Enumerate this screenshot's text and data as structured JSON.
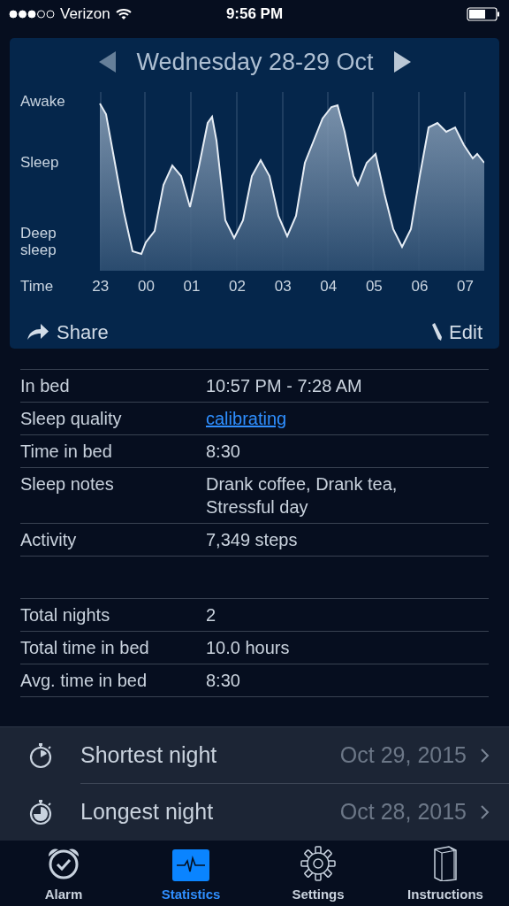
{
  "status_bar": {
    "carrier": "Verizon",
    "time": "9:56 PM"
  },
  "night_card": {
    "title": "Wednesday 28-29 Oct",
    "y_labels": [
      "Awake",
      "Sleep",
      "Deep sleep"
    ],
    "x_axis_label": "Time",
    "x_ticks": [
      "23",
      "00",
      "01",
      "02",
      "03",
      "04",
      "05",
      "06",
      "07"
    ],
    "share": "Share",
    "edit": "Edit"
  },
  "details": [
    {
      "label": "In bed",
      "value": "10:57 PM - 7:28 AM",
      "kind": "text"
    },
    {
      "label": "Sleep quality",
      "value": "calibrating",
      "kind": "link"
    },
    {
      "label": "Time in bed",
      "value": "8:30",
      "kind": "text"
    },
    {
      "label": "Sleep notes",
      "value": "Drank coffee, Drank tea, Stressful day",
      "kind": "text"
    },
    {
      "label": "Activity",
      "value": "7,349 steps",
      "kind": "text"
    }
  ],
  "totals": [
    {
      "label": "Total nights",
      "value": "2"
    },
    {
      "label": "Total time in bed",
      "value": "10.0 hours"
    },
    {
      "label": "Avg. time in bed",
      "value": "8:30"
    }
  ],
  "records": [
    {
      "label": "Shortest night",
      "date": "Oct 29, 2015",
      "kind": "shortest"
    },
    {
      "label": "Longest night",
      "date": "Oct 28, 2015",
      "kind": "longest"
    }
  ],
  "tabs": [
    {
      "label": "Alarm",
      "kind": "alarm",
      "selected": false
    },
    {
      "label": "Statistics",
      "kind": "statistics",
      "selected": true
    },
    {
      "label": "Settings",
      "kind": "settings",
      "selected": false
    },
    {
      "label": "Instructions",
      "kind": "instructions",
      "selected": false
    }
  ]
}
